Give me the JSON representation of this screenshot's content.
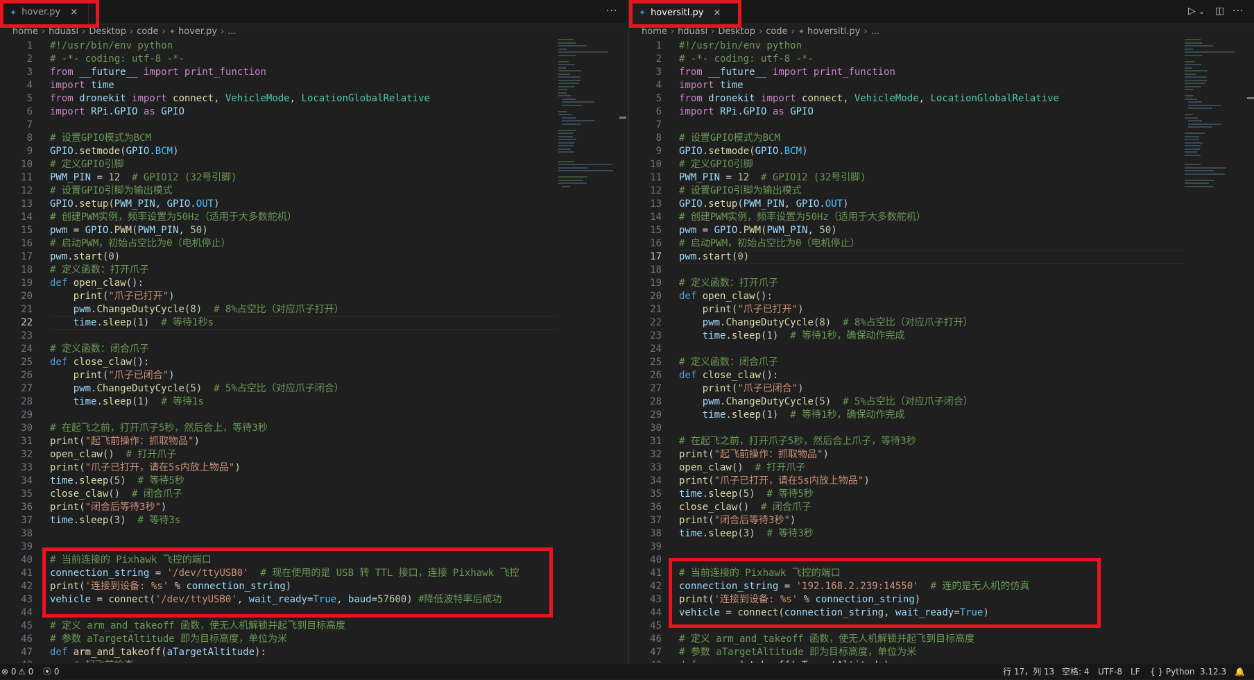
{
  "left": {
    "tab": {
      "label": "hover.py",
      "close": "×"
    },
    "more_label": "···",
    "breadcrumb": [
      "home",
      "hduasl",
      "Desktop",
      "code",
      "hover.py",
      "..."
    ],
    "current_line": 22,
    "lines": [
      "#!/usr/bin/env python",
      "# -*- coding: utf-8 -*-",
      "from __future__ import print_function",
      "import time",
      "from dronekit import connect, VehicleMode, LocationGlobalRelative",
      "import RPi.GPIO as GPIO",
      "",
      "# 设置GPIO模式为BCM",
      "GPIO.setmode(GPIO.BCM)",
      "# 定义GPIO引脚",
      "PWM_PIN = 12  # GPIO12 (32号引脚)",
      "# 设置GPIO引脚为输出模式",
      "GPIO.setup(PWM_PIN, GPIO.OUT)",
      "# 创建PWM实例，频率设置为50Hz（适用于大多数舵机）",
      "pwm = GPIO.PWM(PWM_PIN, 50)",
      "# 启动PWM，初始占空比为0（电机停止）",
      "pwm.start(0)",
      "# 定义函数：打开爪子",
      "def open_claw():",
      "    print(\"爪子已打开\")",
      "    pwm.ChangeDutyCycle(8)  # 8%占空比（对应爪子打开）",
      "    time.sleep(1)  # 等待1秒s",
      "",
      "# 定义函数：闭合爪子",
      "def close_claw():",
      "    print(\"爪子已闭合\")",
      "    pwm.ChangeDutyCycle(5)  # 5%占空比（对应爪子闭合）",
      "    time.sleep(1)  # 等待1s",
      "",
      "# 在起飞之前，打开爪子5秒，然后合上，等待3秒",
      "print(\"起飞前操作：抓取物品\")",
      "open_claw()  # 打开爪子",
      "print(\"爪子已打开，请在5s内放上物品\")",
      "time.sleep(5)  # 等待5秒",
      "close_claw()  # 闭合爪子",
      "print(\"闭合后等待3秒\")",
      "time.sleep(3)  # 等待3s",
      "",
      "",
      "# 当前连接的 Pixhawk 飞控的端口",
      "connection_string = '/dev/ttyUSB0'  # 现在使用的是 USB 转 TTL 接口，连接 Pixhawk 飞控",
      "print('连接到设备: %s' % connection_string)",
      "vehicle = connect('/dev/ttyUSB0', wait_ready=True, baud=57600) #降低波特率后成功",
      "",
      "# 定义 arm_and_takeoff 函数，使无人机解锁并起飞到目标高度",
      "# 参数 aTargetAltitude 即为目标高度，单位为米",
      "def arm_and_takeoff(aTargetAltitude):",
      "    # 起飞前检查"
    ]
  },
  "right": {
    "tab": {
      "label": "hoversitl.py",
      "close": "×"
    },
    "run_icon": "▷",
    "run_dropdown": "⌄",
    "split_icon": "◫",
    "more_label": "···",
    "breadcrumb": [
      "home",
      "hduasl",
      "Desktop",
      "code",
      "hoversitl.py",
      "..."
    ],
    "current_line": 17,
    "lines": [
      "#!/usr/bin/env python",
      "# -*- coding: utf-8 -*-",
      "from __future__ import print_function",
      "import time",
      "from dronekit import connect, VehicleMode, LocationGlobalRelative",
      "import RPi.GPIO as GPIO",
      "",
      "# 设置GPIO模式为BCM",
      "GPIO.setmode(GPIO.BCM)",
      "# 定义GPIO引脚",
      "PWM_PIN = 12  # GPIO12 (32号引脚)",
      "# 设置GPIO引脚为输出模式",
      "GPIO.setup(PWM_PIN, GPIO.OUT)",
      "# 创建PWM实例，频率设置为50Hz（适用于大多数舵机）",
      "pwm = GPIO.PWM(PWM_PIN, 50)",
      "# 启动PWM，初始占空比为0（电机停止）",
      "pwm.start(0)",
      "",
      "# 定义函数：打开爪子",
      "def open_claw():",
      "    print(\"爪子已打开\")",
      "    pwm.ChangeDutyCycle(8)  # 8%占空比（对应爪子打开）",
      "    time.sleep(1)  # 等待1秒，确保动作完成",
      "",
      "# 定义函数：闭合爪子",
      "def close_claw():",
      "    print(\"爪子已闭合\")",
      "    pwm.ChangeDutyCycle(5)  # 5%占空比（对应爪子闭合）",
      "    time.sleep(1)  # 等待1秒，确保动作完成",
      "",
      "# 在起飞之前，打开爪子5秒，然后合上爪子，等待3秒",
      "print(\"起飞前操作：抓取物品\")",
      "open_claw()  # 打开爪子",
      "print(\"爪子已打开，请在5s内放上物品\")",
      "time.sleep(5)  # 等待5秒",
      "close_claw()  # 闭合爪子",
      "print(\"闭合后等待3秒\")",
      "time.sleep(3)  # 等待3秒",
      "",
      "",
      "# 当前连接的 Pixhawk 飞控的端口",
      "connection_string = '192.168.2.239:14550'  # 连的是无人机的仿真",
      "print('连接到设备: %s' % connection_string)",
      "vehicle = connect(connection_string, wait_ready=True)",
      "",
      "# 定义 arm_and_takeoff 函数，使无人机解锁并起飞到目标高度",
      "# 参数 aTargetAltitude 即为目标高度，单位为米",
      "def arm_and_takeoff(aTargetAltitude):"
    ]
  },
  "status": {
    "errors": "⊗ 0",
    "warnings": "⚠ 0",
    "ports": "⦿ 0",
    "position": "行 17，列 13",
    "spaces": "空格: 4",
    "encoding": "UTF-8",
    "eol": "LF",
    "language": "{ } Python",
    "version": "3.12.3",
    "bell": "🔔"
  },
  "colors": {
    "highlight_box": "#e8141e",
    "editor_bg": "#1f1f1f",
    "accent": "#0078d4"
  }
}
